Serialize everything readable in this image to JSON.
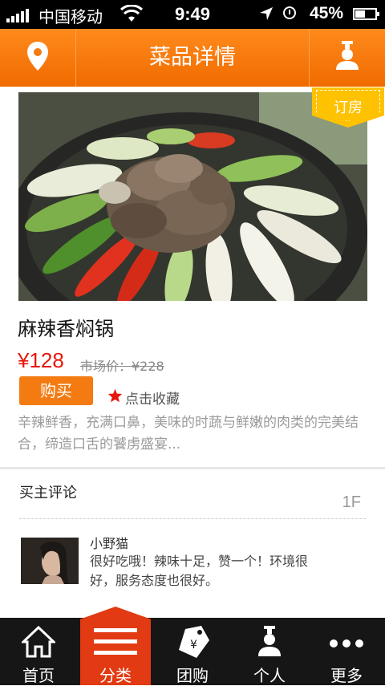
{
  "status_bar": {
    "carrier": "中国移动",
    "time": "9:49",
    "battery": "45%"
  },
  "nav": {
    "title": "菜品详情",
    "left_icon": "location-pin-icon",
    "right_icon": "user-icon"
  },
  "badge": {
    "label": "订房"
  },
  "dish": {
    "name": "麻辣香焖锅",
    "price": "¥128",
    "market_price": "市场价：¥228",
    "buy_label": "购买",
    "favorite_label": "点击收藏",
    "description": "辛辣鲜香，充满口鼻，美味的时蔬与鲜嫩的肉类的完美结合，缔造口舌的饕虏盛宴..."
  },
  "reviews": {
    "section_title": "买主评论",
    "items": [
      {
        "floor": "1F",
        "user": "小野猫",
        "text": "很好吃哦！辣味十足，赞一个！环境很好，服务态度也很好。"
      }
    ]
  },
  "tabbar": {
    "tabs": [
      {
        "label": "首页",
        "icon": "home-icon"
      },
      {
        "label": "分类",
        "icon": "category-menu-icon",
        "active": true
      },
      {
        "label": "团购",
        "icon": "group-buy-tag-icon"
      },
      {
        "label": "个人",
        "icon": "user-icon"
      },
      {
        "label": "更多",
        "icon": "more-icon"
      }
    ]
  },
  "colors": {
    "accent": "#f47b12",
    "price": "#e6180c",
    "active_tab": "#e23a12",
    "badge": "#ffc200"
  }
}
